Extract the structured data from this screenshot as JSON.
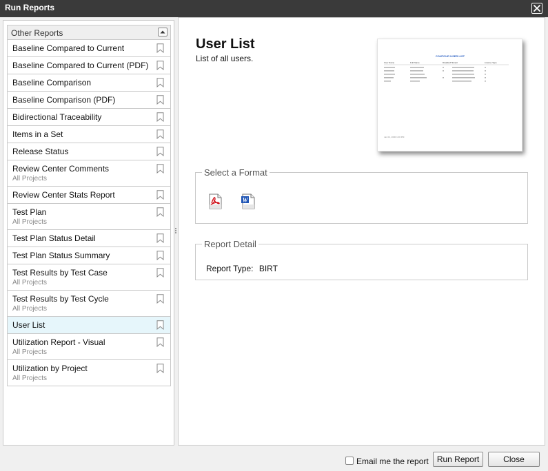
{
  "window": {
    "title": "Run Reports"
  },
  "list": {
    "header": "Other Reports",
    "items": [
      {
        "name": "Baseline Compared to Current",
        "sub": ""
      },
      {
        "name": "Baseline Compared to Current (PDF)",
        "sub": ""
      },
      {
        "name": "Baseline Comparison",
        "sub": ""
      },
      {
        "name": "Baseline Comparison (PDF)",
        "sub": ""
      },
      {
        "name": "Bidirectional Traceability",
        "sub": ""
      },
      {
        "name": "Items in a Set",
        "sub": ""
      },
      {
        "name": "Release Status",
        "sub": ""
      },
      {
        "name": "Review Center Comments",
        "sub": "All Projects"
      },
      {
        "name": "Review Center Stats Report",
        "sub": ""
      },
      {
        "name": "Test Plan",
        "sub": "All Projects"
      },
      {
        "name": "Test Plan Status Detail",
        "sub": ""
      },
      {
        "name": "Test Plan Status Summary",
        "sub": ""
      },
      {
        "name": "Test Results by Test Case",
        "sub": "All Projects"
      },
      {
        "name": "Test Results by Test Cycle",
        "sub": "All Projects"
      },
      {
        "name": "User List",
        "sub": "",
        "selected": true
      },
      {
        "name": "Utilization Report - Visual",
        "sub": "All Projects"
      },
      {
        "name": "Utilization by Project",
        "sub": "All Projects"
      }
    ]
  },
  "detail": {
    "title": "User List",
    "description": "List of all users.",
    "preview": {
      "heading": "CONTOUR USER LIST",
      "columns": [
        "User Name",
        "Full Name",
        "Disabled?",
        "Email",
        "License Type"
      ],
      "footer": "Jan 01, 2000 1:00 PM"
    },
    "format_legend": "Select a Format",
    "formats": [
      {
        "icon": "pdf-icon"
      },
      {
        "icon": "word-icon"
      }
    ],
    "report_detail_legend": "Report Detail",
    "report_type_label": "Report Type:",
    "report_type_value": "BIRT"
  },
  "footer": {
    "email_label": "Email me the report",
    "email_checked": false,
    "run_label": "Run Report",
    "close_label": "Close"
  },
  "colors": {
    "titlebar": "#3a3a3a",
    "selected_row": "#e6f6fb",
    "preview_heading": "#2f63c4"
  }
}
